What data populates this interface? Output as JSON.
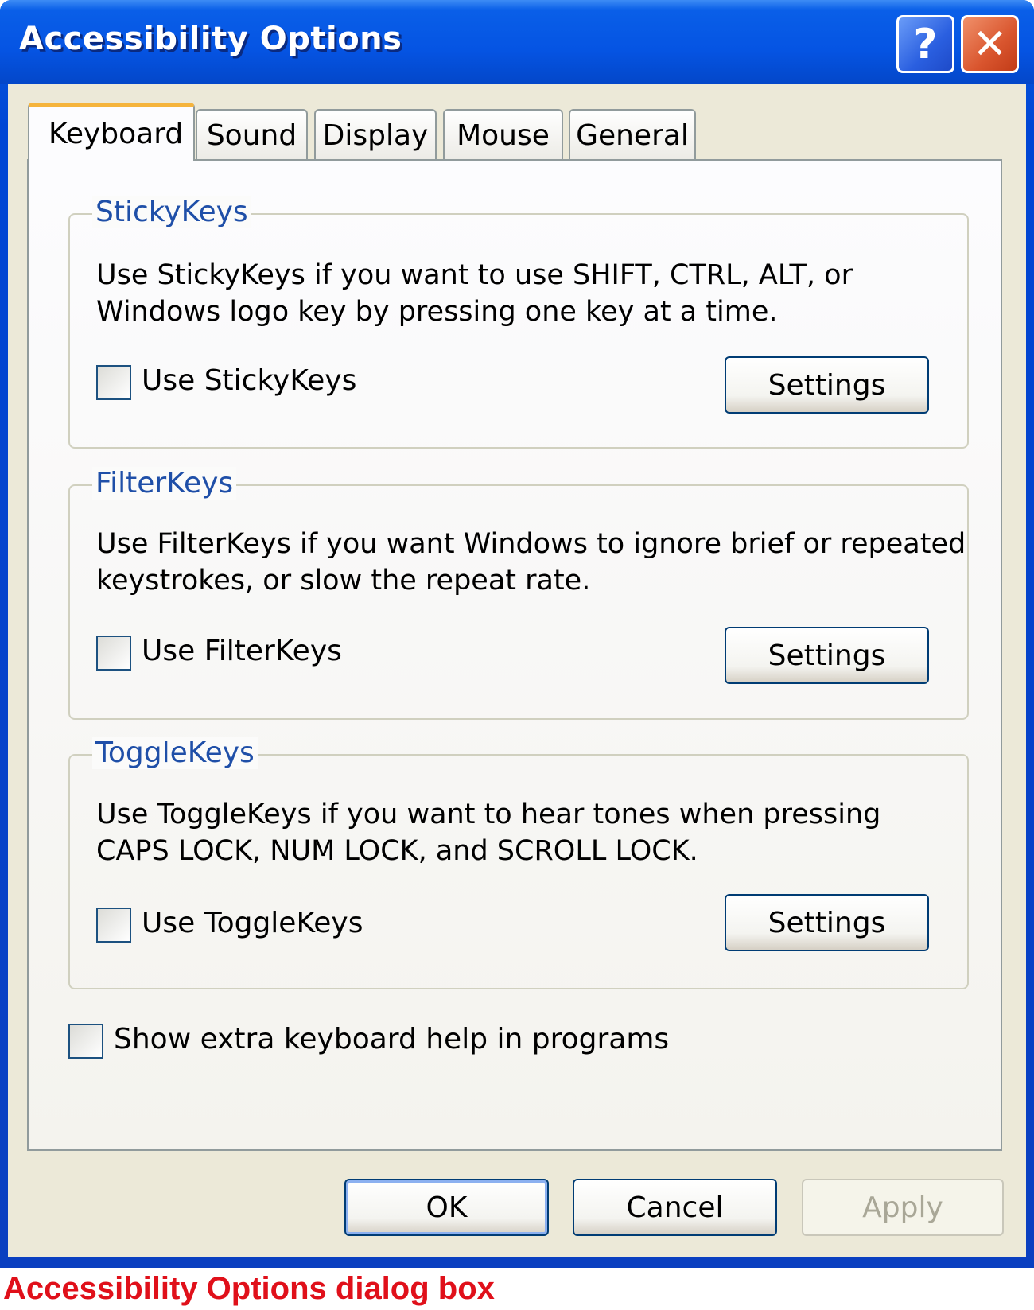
{
  "window": {
    "title": "Accessibility Options",
    "help_icon": "?",
    "close_icon": "✕"
  },
  "tabs": [
    {
      "label": "Keyboard",
      "active": true
    },
    {
      "label": "Sound"
    },
    {
      "label": "Display"
    },
    {
      "label": "Mouse"
    },
    {
      "label": "General"
    }
  ],
  "groups": [
    {
      "legend": "StickyKeys",
      "desc": [
        "Use StickyKeys if you want to use SHIFT, CTRL, ALT, or",
        "Windows logo key by pressing one key at a time."
      ],
      "checkbox": "Use StickyKeys",
      "checked": false,
      "button": "Settings"
    },
    {
      "legend": "FilterKeys",
      "desc": [
        "Use FilterKeys if you want Windows to ignore brief or repeated",
        "keystrokes, or slow the repeat rate."
      ],
      "checkbox": "Use FilterKeys",
      "checked": false,
      "button": "Settings"
    },
    {
      "legend": "ToggleKeys",
      "desc": [
        "Use ToggleKeys if you want to hear tones when pressing",
        "CAPS LOCK, NUM LOCK, and SCROLL LOCK."
      ],
      "checkbox": "Use ToggleKeys",
      "checked": false,
      "button": "Settings"
    }
  ],
  "extra_help": {
    "label": "Show extra keyboard help in programs",
    "checked": false
  },
  "buttons": {
    "ok": "OK",
    "cancel": "Cancel",
    "apply": "Apply",
    "apply_disabled": true
  },
  "caption": "Accessibility Options dialog box",
  "colors": {
    "title_bar": "#0554e3",
    "close": "#d9552e",
    "legend": "#1f4fa8",
    "caption": "#e0101a",
    "face": "#ece9d8"
  }
}
